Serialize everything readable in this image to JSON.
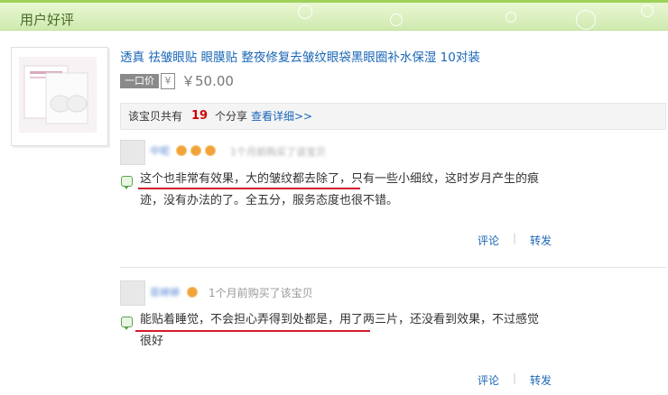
{
  "header": {
    "title": "用户好评"
  },
  "product": {
    "title": "透真 祛皱眼贴 眼膜贴 整夜修复去皱纹眼袋黑眼圈补水保湿 10对装",
    "price_label": "一口价",
    "currency_icon": "¥",
    "price": "￥50.00"
  },
  "share": {
    "prefix": "该宝贝共有",
    "count": "19",
    "suffix": "个分享",
    "link": "查看详细>>"
  },
  "reviews": [
    {
      "username": "中呢",
      "meta": "1个月前购买了该宝贝",
      "text_line1": "这个也非常有效果，大的皱纹都去除了，只有一些小细纹，这时岁月产生的痕",
      "text_line2": "迹，没有办法的了。全五分，服务态度也很不错。",
      "comment": "评论",
      "forward": "转发"
    },
    {
      "username": "菲婷婷",
      "meta": "1个月前购买了该宝贝",
      "text_line1": "能贴着睡觉，不会担心弄得到处都是，用了两三片，还没看到效果，不过感觉",
      "text_line2": "很好",
      "comment": "评论",
      "forward": "转发"
    }
  ],
  "colors": {
    "accent_green": "#9fd15a",
    "link_blue": "#1a66b7",
    "highlight_red": "#d41a2e"
  }
}
